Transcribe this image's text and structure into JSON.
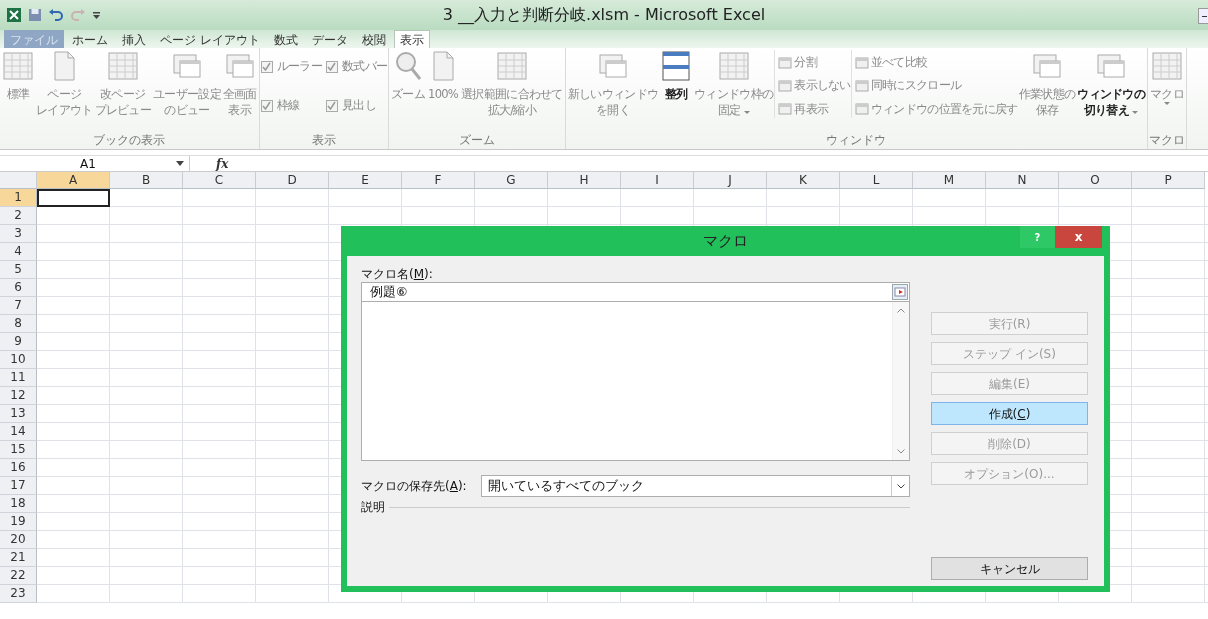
{
  "window": {
    "title": "3 __入力と判断分岐.xlsm - Microsoft Excel"
  },
  "ribbon": {
    "tabs": [
      {
        "label": "ファイル",
        "kind": "file",
        "selected": false
      },
      {
        "label": "ホーム",
        "kind": "tab",
        "selected": false
      },
      {
        "label": "挿入",
        "kind": "tab",
        "selected": false
      },
      {
        "label": "ページ レイアウト",
        "kind": "tab",
        "selected": false
      },
      {
        "label": "数式",
        "kind": "tab",
        "selected": false
      },
      {
        "label": "データ",
        "kind": "tab",
        "selected": false
      },
      {
        "label": "校閲",
        "kind": "tab",
        "selected": false
      },
      {
        "label": "表示",
        "kind": "tab",
        "selected": true
      }
    ],
    "groups": [
      {
        "label": "ブックの表示",
        "items": [
          {
            "kind": "large",
            "lines": [
              "標準"
            ],
            "disabled": true
          },
          {
            "kind": "large",
            "lines": [
              "ページ",
              "レイアウト"
            ],
            "disabled": true
          },
          {
            "kind": "large",
            "lines": [
              "改ページ",
              "プレビュー"
            ],
            "disabled": true
          },
          {
            "kind": "large",
            "lines": [
              "ユーザー設定",
              "のビュー"
            ],
            "disabled": true
          },
          {
            "kind": "large",
            "lines": [
              "全画面",
              "表示"
            ],
            "disabled": true
          }
        ]
      },
      {
        "label": "表示",
        "items": [
          {
            "kind": "checks",
            "items": [
              {
                "label": "ルーラー",
                "checked": true
              },
              {
                "label": "数式バー",
                "checked": true
              },
              {
                "label": "枠線",
                "checked": true
              },
              {
                "label": "見出し",
                "checked": true
              }
            ]
          }
        ]
      },
      {
        "label": "ズーム",
        "items": [
          {
            "kind": "large",
            "lines": [
              "ズーム"
            ],
            "disabled": true
          },
          {
            "kind": "large",
            "lines": [
              "100%"
            ],
            "disabled": true
          },
          {
            "kind": "large",
            "lines": [
              "選択範囲に合わせて",
              "拡大/縮小"
            ],
            "disabled": true
          }
        ]
      },
      {
        "label": "ウィンドウ",
        "items": [
          {
            "kind": "large",
            "lines": [
              "新しいウィンドウ",
              "を開く"
            ],
            "disabled": true
          },
          {
            "kind": "large",
            "lines": [
              "整列"
            ],
            "disabled": false
          },
          {
            "kind": "large",
            "lines": [
              "ウィンドウ枠の",
              "固定"
            ],
            "disabled": true,
            "dropdown": true
          },
          {
            "kind": "stack",
            "items": [
              {
                "label": "分割",
                "disabled": true
              },
              {
                "label": "表示しない",
                "disabled": true
              },
              {
                "label": "再表示",
                "disabled": true
              }
            ]
          },
          {
            "kind": "stack",
            "items": [
              {
                "label": "並べて比較",
                "disabled": true
              },
              {
                "label": "同時にスクロール",
                "disabled": true
              },
              {
                "label": "ウィンドウの位置を元に戻す",
                "disabled": true
              }
            ]
          },
          {
            "kind": "large",
            "lines": [
              "作業状態の",
              "保存"
            ],
            "disabled": true
          },
          {
            "kind": "large",
            "lines": [
              "ウィンドウの",
              "切り替え"
            ],
            "disabled": false,
            "dropdown": true
          }
        ]
      },
      {
        "label": "マクロ",
        "items": [
          {
            "kind": "large",
            "lines": [
              "マクロ"
            ],
            "disabled": true,
            "dropdown": true
          }
        ]
      }
    ]
  },
  "formula_bar": {
    "name_box": "A1",
    "fx": "fx"
  },
  "sheet": {
    "columns": [
      {
        "label": "A",
        "selected": true
      },
      {
        "label": "B",
        "selected": false
      },
      {
        "label": "C",
        "selected": false
      },
      {
        "label": "D",
        "selected": false
      },
      {
        "label": "E",
        "selected": false
      },
      {
        "label": "F",
        "selected": false
      },
      {
        "label": "G",
        "selected": false
      },
      {
        "label": "H",
        "selected": false
      },
      {
        "label": "I",
        "selected": false
      },
      {
        "label": "J",
        "selected": false
      },
      {
        "label": "K",
        "selected": false
      },
      {
        "label": "L",
        "selected": false
      },
      {
        "label": "M",
        "selected": false
      },
      {
        "label": "N",
        "selected": false
      },
      {
        "label": "O",
        "selected": false
      },
      {
        "label": "P",
        "selected": false
      }
    ],
    "rows": [
      {
        "label": "1",
        "selected": true
      },
      {
        "label": "2",
        "selected": false
      },
      {
        "label": "3",
        "selected": false
      },
      {
        "label": "4",
        "selected": false
      },
      {
        "label": "5",
        "selected": false
      },
      {
        "label": "6",
        "selected": false
      },
      {
        "label": "7",
        "selected": false
      },
      {
        "label": "8",
        "selected": false
      },
      {
        "label": "9",
        "selected": false
      },
      {
        "label": "10",
        "selected": false
      },
      {
        "label": "11",
        "selected": false
      },
      {
        "label": "12",
        "selected": false
      },
      {
        "label": "13",
        "selected": false
      },
      {
        "label": "14",
        "selected": false
      },
      {
        "label": "15",
        "selected": false
      },
      {
        "label": "16",
        "selected": false
      },
      {
        "label": "17",
        "selected": false
      },
      {
        "label": "18",
        "selected": false
      },
      {
        "label": "19",
        "selected": false
      },
      {
        "label": "20",
        "selected": false
      },
      {
        "label": "21",
        "selected": false
      },
      {
        "label": "22",
        "selected": false
      },
      {
        "label": "23",
        "selected": false
      }
    ]
  },
  "dialog": {
    "title": "マクロ",
    "help": "?",
    "close": "x",
    "name_label": {
      "label": "マクロ名(",
      "accel": "M",
      "label_end": "):"
    },
    "name_value": "例題⑥",
    "store_label": {
      "label": "マクロの保存先(",
      "accel": "A",
      "label_end": "):"
    },
    "store_value": "開いているすべてのブック",
    "description_label": "説明",
    "buttons": [
      {
        "label": "実行(R)",
        "disabled": true,
        "focused": false
      },
      {
        "label": "ステップ イン(S)",
        "disabled": true,
        "focused": false
      },
      {
        "label": "編集(E)",
        "disabled": true,
        "focused": false
      },
      {
        "label": "作成(",
        "accel": "C",
        "label_end": ")",
        "disabled": false,
        "focused": true
      },
      {
        "label": "削除(D)",
        "disabled": true,
        "focused": false
      },
      {
        "label": "オプション(O)...",
        "disabled": true,
        "focused": false
      }
    ],
    "cancel": {
      "label": "キャンセル",
      "disabled": false,
      "focused": false
    }
  }
}
